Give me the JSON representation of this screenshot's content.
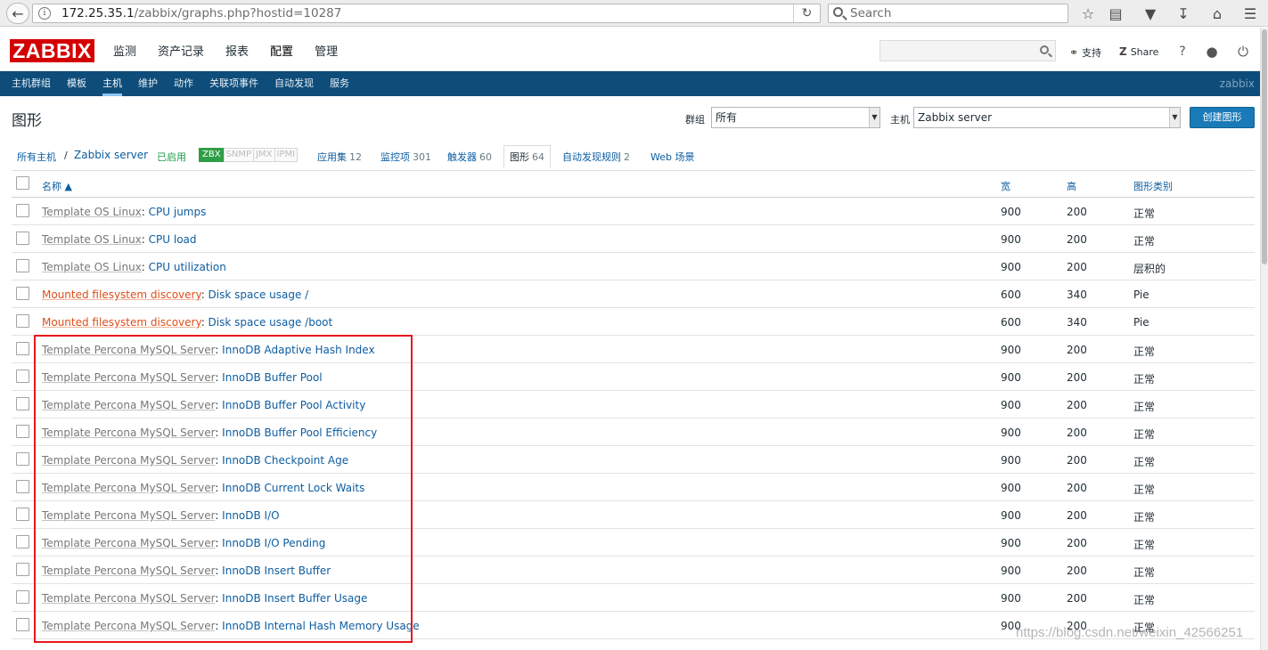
{
  "browser": {
    "url_host": "172.25.35.1",
    "url_path": "/zabbix/graphs.php?hostid=10287",
    "search_placeholder": "Search"
  },
  "header": {
    "logo": "ZABBIX",
    "menu": [
      "监测",
      "资产记录",
      "报表",
      "配置",
      "管理"
    ],
    "support_label": "支持",
    "share_label": "Share",
    "help_label": "?"
  },
  "submenu": {
    "items": [
      "主机群组",
      "模板",
      "主机",
      "维护",
      "动作",
      "关联项事件",
      "自动发现",
      "服务"
    ],
    "user": "zabbix"
  },
  "page": {
    "title": "图形",
    "group_label": "群组",
    "group_value": "所有",
    "host_label": "主机",
    "host_value": "Zabbix server",
    "create_button": "创建图形"
  },
  "host_nav": {
    "all_hosts": "所有主机",
    "separator": "/",
    "host": "Zabbix server",
    "status": "已启用",
    "availability": [
      "ZBX",
      "SNMP",
      "JMX",
      "IPMI"
    ],
    "apps_label": "应用集",
    "apps_count": "12",
    "items_label": "监控项",
    "items_count": "301",
    "triggers_label": "触发器",
    "triggers_count": "60",
    "graphs_label": "图形",
    "graphs_count": "64",
    "discovery_label": "自动发现规则",
    "discovery_count": "2",
    "web_label": "Web 场景"
  },
  "table": {
    "headers": {
      "name": "名称",
      "width": "宽",
      "height": "高",
      "type": "图形类别"
    },
    "rows": [
      {
        "template": "Template OS Linux",
        "name": "CPU jumps",
        "width": "900",
        "height": "200",
        "type": "正常"
      },
      {
        "template": "Template OS Linux",
        "name": "CPU load",
        "width": "900",
        "height": "200",
        "type": "正常"
      },
      {
        "template": "Template OS Linux",
        "name": "CPU utilization",
        "width": "900",
        "height": "200",
        "type": "层积的"
      },
      {
        "template": "Mounted filesystem discovery",
        "name": "Disk space usage /",
        "width": "600",
        "height": "340",
        "type": "Pie"
      },
      {
        "template": "Mounted filesystem discovery",
        "name": "Disk space usage /boot",
        "width": "600",
        "height": "340",
        "type": "Pie"
      },
      {
        "template": "Template Percona MySQL Server",
        "name": "InnoDB Adaptive Hash Index",
        "width": "900",
        "height": "200",
        "type": "正常"
      },
      {
        "template": "Template Percona MySQL Server",
        "name": "InnoDB Buffer Pool",
        "width": "900",
        "height": "200",
        "type": "正常"
      },
      {
        "template": "Template Percona MySQL Server",
        "name": "InnoDB Buffer Pool Activity",
        "width": "900",
        "height": "200",
        "type": "正常"
      },
      {
        "template": "Template Percona MySQL Server",
        "name": "InnoDB Buffer Pool Efficiency",
        "width": "900",
        "height": "200",
        "type": "正常"
      },
      {
        "template": "Template Percona MySQL Server",
        "name": "InnoDB Checkpoint Age",
        "width": "900",
        "height": "200",
        "type": "正常"
      },
      {
        "template": "Template Percona MySQL Server",
        "name": "InnoDB Current Lock Waits",
        "width": "900",
        "height": "200",
        "type": "正常"
      },
      {
        "template": "Template Percona MySQL Server",
        "name": "InnoDB I/O",
        "width": "900",
        "height": "200",
        "type": "正常"
      },
      {
        "template": "Template Percona MySQL Server",
        "name": "InnoDB I/O Pending",
        "width": "900",
        "height": "200",
        "type": "正常"
      },
      {
        "template": "Template Percona MySQL Server",
        "name": "InnoDB Insert Buffer",
        "width": "900",
        "height": "200",
        "type": "正常"
      },
      {
        "template": "Template Percona MySQL Server",
        "name": "InnoDB Insert Buffer Usage",
        "width": "900",
        "height": "200",
        "type": "正常"
      },
      {
        "template": "Template Percona MySQL Server",
        "name": "InnoDB Internal Hash Memory Usage",
        "width": "900",
        "height": "200",
        "type": "正常"
      }
    ]
  },
  "watermark": "https://blog.csdn.net/weixin_42566251",
  "colors": {
    "brand": "#d40000",
    "submenu_bg": "#0e4d7a",
    "link": "#0e5da0",
    "highlight": "#e8171c"
  }
}
